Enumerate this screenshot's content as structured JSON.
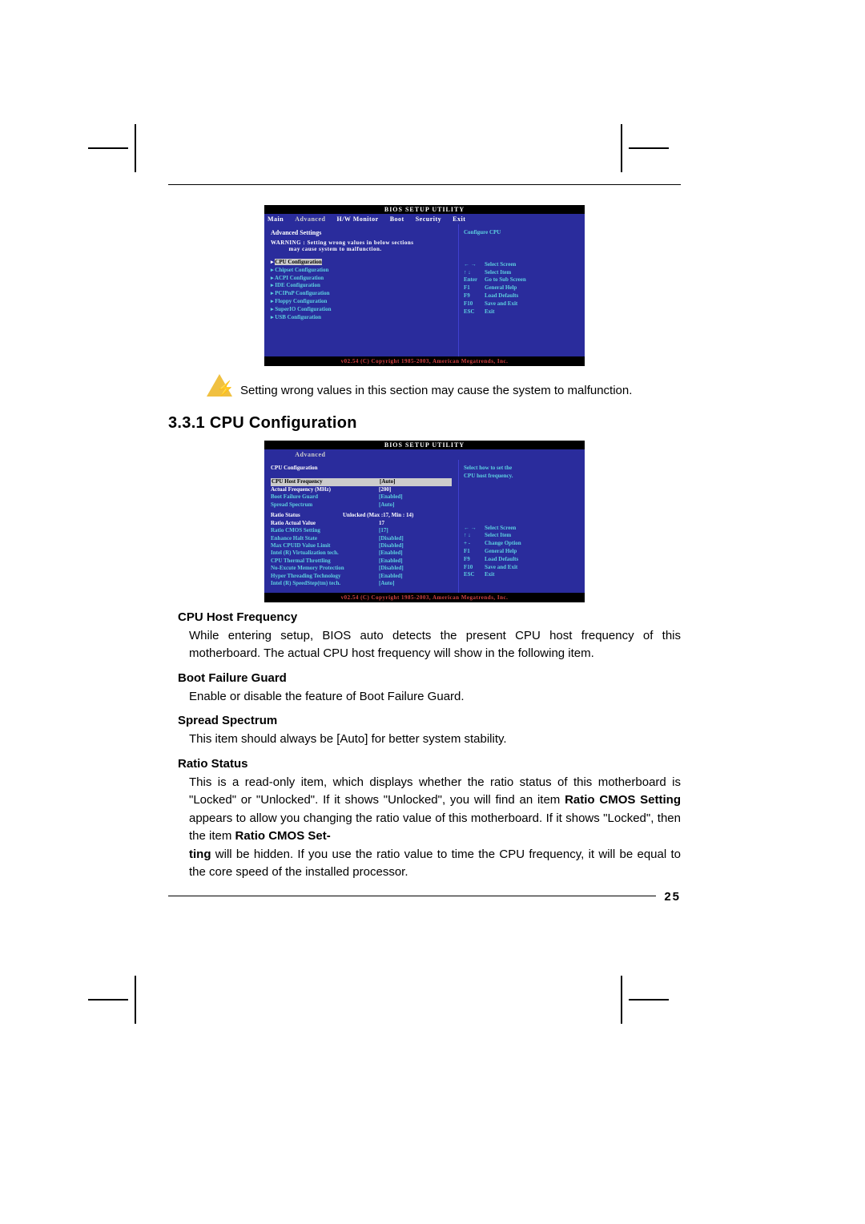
{
  "bios_title": "BIOS SETUP UTILITY",
  "footer": "v02.54 (C) Copyright 1985-2003, American Megatrends, Inc.",
  "tabs": {
    "main": "Main",
    "advanced": "Advanced",
    "hw": "H/W Monitor",
    "boot": "Boot",
    "security": "Security",
    "exit": "Exit"
  },
  "adv_screen": {
    "heading": "Advanced Settings",
    "warning1": "WARNING : Setting wrong values in below sections",
    "warning2": "may cause system to malfunction.",
    "menu": [
      "CPU Configuration",
      "Chipset Configuration",
      "ACPI Configuration",
      "IDE Configuration",
      "PCIPnP Configuration",
      "Floppy Configuration",
      "SuperIO Configuration",
      "USB Configuration"
    ],
    "right_title": "Configure CPU",
    "help": [
      {
        "k": "← →",
        "v": "Select Screen"
      },
      {
        "k": "↑ ↓",
        "v": "Select Item"
      },
      {
        "k": "Enter",
        "v": "Go to Sub Screen"
      },
      {
        "k": "F1",
        "v": "General Help"
      },
      {
        "k": "F9",
        "v": "Load Defaults"
      },
      {
        "k": "F10",
        "v": "Save and Exit"
      },
      {
        "k": "ESC",
        "v": "Exit"
      }
    ]
  },
  "warn_text": "Setting wrong values in this section may cause the system to malfunction.",
  "section_title": "3.3.1 CPU Configuration",
  "cpu_screen": {
    "heading": "CPU Configuration",
    "right_title1": "Select how to set the",
    "right_title2": "CPU host frequency.",
    "rows": [
      {
        "l": "CPU Host Frequency",
        "v": "[Auto]",
        "sel": true
      },
      {
        "l": "   Actual Frequency (MHz)",
        "v": "[200]",
        "white": true
      },
      {
        "l": "Boot Failure Guard",
        "v": "[Enabled]"
      },
      {
        "l": "Spread Spectrum",
        "v": "[Auto]"
      }
    ],
    "ratio_status_l": "Ratio Status",
    "ratio_status_v": "Unlocked (Max :17, Min : 14)",
    "ratio_actual_l": "Ratio Actual Value",
    "ratio_actual_v": "17",
    "ratio_cmos_l": "   Ratio CMOS Setting",
    "ratio_cmos_v": "[17]",
    "rows2": [
      {
        "l": "Enhance Halt State",
        "v": "[Disabled]"
      },
      {
        "l": "Max CPUID Value Limit",
        "v": "[Disabled]"
      },
      {
        "l": "Intel (R) Virtualization tech.",
        "v": "[Enabled]"
      },
      {
        "l": "CPU Thermal Throttling",
        "v": "[Enabled]"
      },
      {
        "l": "No-Excute Memory Protection",
        "v": "[Disabled]"
      },
      {
        "l": "Hyper Threading Technology",
        "v": "[Enabled]"
      },
      {
        "l": "Intel (R) SpeedStep(tm) tech.",
        "v": "[Auto]"
      }
    ],
    "help": [
      {
        "k": "← →",
        "v": "Select Screen"
      },
      {
        "k": "↑ ↓",
        "v": "Select Item"
      },
      {
        "k": "+ -",
        "v": "Change Option"
      },
      {
        "k": "F1",
        "v": "General Help"
      },
      {
        "k": "F9",
        "v": "Load Defaults"
      },
      {
        "k": "F10",
        "v": "Save and Exit"
      },
      {
        "k": "ESC",
        "v": "Exit"
      }
    ]
  },
  "body": {
    "h1": "CPU Host Frequency",
    "p1": "While entering setup, BIOS auto detects the present CPU host frequency of this motherboard. The actual CPU host frequency will show in the following item.",
    "h2": "Boot Failure Guard",
    "p2": "Enable or disable the feature of Boot Failure Guard.",
    "h3": "Spread Spectrum",
    "p3": "This item should always be [Auto] for better system stability.",
    "h4": "Ratio Status",
    "p4a": "This is a read-only item, which displays whether the ratio status of this motherboard is \"Locked\" or \"Unlocked\". If it shows \"Unlocked\", you will find an item ",
    "p4b": "Ratio CMOS Setting",
    "p4c": " appears to allow you changing the ratio value of this motherboard. If it shows \"Locked\", then the item ",
    "p4d": "Ratio CMOS Set-",
    "p4e": "ting",
    "p4f": " will be hidden. If you use the ratio value to time the CPU frequency, it will be equal to the core speed of the installed processor."
  },
  "page_number": "25"
}
